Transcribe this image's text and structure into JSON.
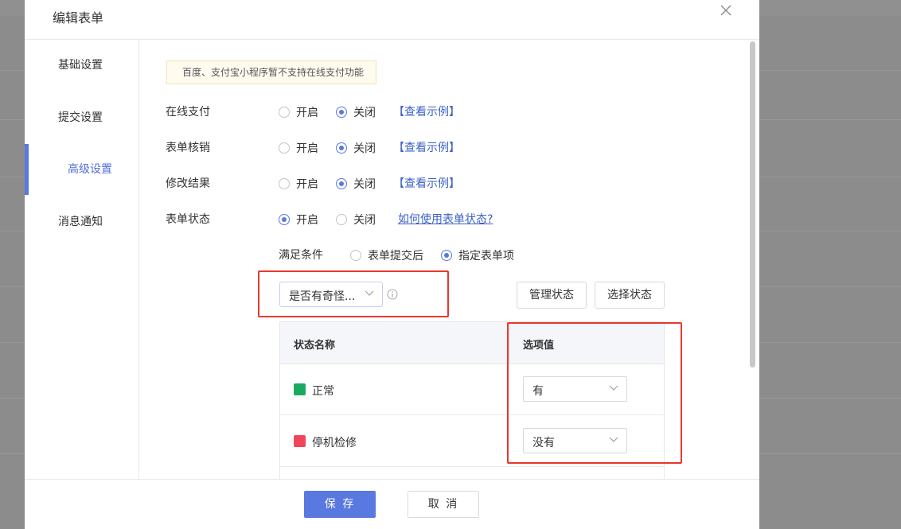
{
  "dialog": {
    "title": "编辑表单",
    "close_icon": "close-icon"
  },
  "sidebar": {
    "items": [
      {
        "label": "基础设置",
        "active": false
      },
      {
        "label": "提交设置",
        "active": false
      },
      {
        "label": "高级设置",
        "active": true
      },
      {
        "label": "消息通知",
        "active": false
      }
    ]
  },
  "main": {
    "notice": "百度、支付宝小程序暂不支持在线支付功能",
    "online_pay": {
      "label": "在线支付",
      "on": "开启",
      "off": "关闭",
      "selected": "关闭",
      "link": "【查看示例】"
    },
    "verify": {
      "label": "表单核销",
      "on": "开启",
      "off": "关闭",
      "selected": "关闭",
      "link": "【查看示例】"
    },
    "modify_result": {
      "label": "修改结果",
      "on": "开启",
      "off": "关闭",
      "selected": "关闭",
      "link": "【查看示例】"
    },
    "form_status": {
      "label": "表单状态",
      "on": "开启",
      "off": "关闭",
      "selected": "开启",
      "link": "如何使用表单状态?"
    },
    "condition": {
      "label": "满足条件",
      "option_after_submit": "表单提交后",
      "option_specified": "指定表单项",
      "selected": "指定表单项"
    },
    "field_select": {
      "value": "是否有奇怪...",
      "icon": "info-icon"
    },
    "manage_status_button": "管理状态",
    "select_status_button": "选择状态",
    "status_table": {
      "headers": [
        "状态名称",
        "选项值"
      ],
      "rows": [
        {
          "name": "正常",
          "color": "#1aa960",
          "option": "有"
        },
        {
          "name": "停机检修",
          "color": "#f0465a",
          "option": "没有"
        }
      ]
    }
  },
  "footer": {
    "save_label": "保 存",
    "cancel_label": "取 消"
  },
  "colors": {
    "accent": "#5978e0",
    "link": "#3c61c6",
    "highlight_box": "#e8372e"
  }
}
